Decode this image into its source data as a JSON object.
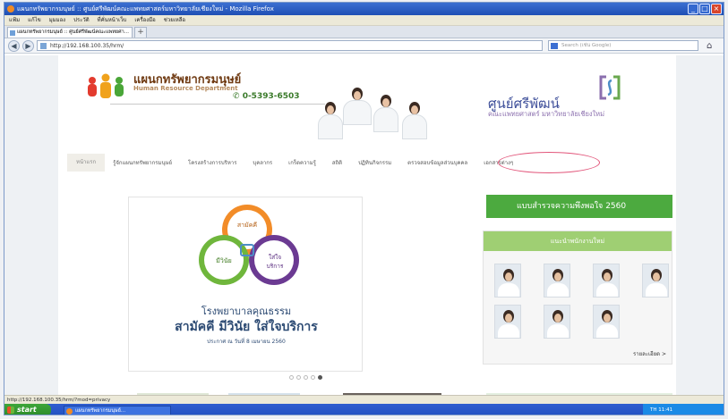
{
  "browser": {
    "window_title": "แผนกทรัพยากรมนุษย์ :: ศูนย์ศรีพัฒน์คณะแพทยศาสตร์มหาวิทยาลัยเชียงใหม่ - Mozilla Firefox",
    "menu": [
      "แฟ้ม",
      "แก้ไข",
      "มุมมอง",
      "ประวัติ",
      "ที่คั่นหน้าเว็บ",
      "เครื่องมือ",
      "ช่วยเหลือ"
    ],
    "tab_label": "แผนกทรัพยากรมนุษย์ :: ศูนย์ศรีพัฒน์คณะแพทยศา...",
    "new_tab": "+",
    "url": "http://192.168.100.35/hrm/",
    "search_placeholder": "Search (เช่น Google)",
    "status_url": "http://192.168.100.35/hrm/?mod=privacy"
  },
  "header": {
    "hr_title": "แผนกทรัพยากรมนุษย์",
    "hr_subtitle": "Human Resource Department",
    "phone": "0-5393-6503",
    "center_name": "ศูนย์ศรีพัฒน์",
    "center_subtitle": "คณะแพทยศาสตร์ มหาวิทยาลัยเชียงใหม่"
  },
  "nav": {
    "items": [
      "หน้าแรก",
      "รู้จักแผนกทรัพยากรมนุษย์",
      "โครงสร้างการบริหาร",
      "บุคลากร",
      "เกร็ดความรู้",
      "สถิติ",
      "ปฏิทินกิจกรรม",
      "ตรวจสอบข้อมูลส่วนบุคคล",
      "เอกสารต่างๆ"
    ]
  },
  "slider": {
    "venn_top": "สามัคคี",
    "venn_left": "มีวินัย",
    "venn_right": "ใส่ใจ บริการ",
    "line1": "โรงพยาบาลคุณธรรม",
    "line2": "สามัคคี มีวินัย ใส่ใจบริการ",
    "line3": "ประกาศ ณ วันที่ 8 เมษายน 2560"
  },
  "sidebar": {
    "survey_label": "แบบสำรวจความพึงพอใจ 2560",
    "newstaff_title": "แนะนำพนักงานใหม่",
    "read_more": "รายละเอียด >"
  },
  "taskbar": {
    "start_label": "start",
    "task_label": "แผนกทรัพยากรมนุษย์...",
    "tray_text": "TH  11:41"
  },
  "colors": {
    "survey_green": "#4caa3f",
    "newstaff_header": "#9fcf73",
    "hr_brown": "#6f3a12",
    "center_blue": "#3e4f9a",
    "highlight_circle": "#e2557a"
  }
}
